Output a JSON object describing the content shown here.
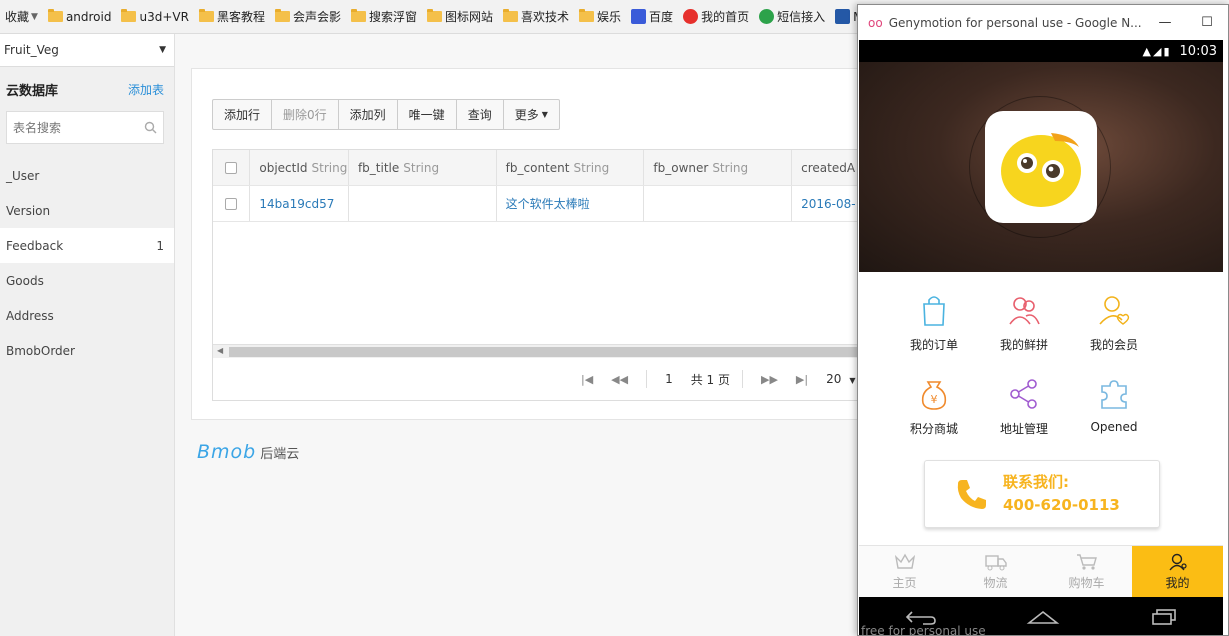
{
  "bookmarks": [
    {
      "label": "收藏",
      "kind": "menu"
    },
    {
      "label": "android",
      "kind": "folder"
    },
    {
      "label": "u3d+VR",
      "kind": "folder"
    },
    {
      "label": "黑客教程",
      "kind": "folder"
    },
    {
      "label": "会声会影",
      "kind": "folder"
    },
    {
      "label": "搜索浮窗",
      "kind": "folder"
    },
    {
      "label": "图标网站",
      "kind": "folder"
    },
    {
      "label": "喜欢技术",
      "kind": "folder"
    },
    {
      "label": "娱乐",
      "kind": "folder"
    },
    {
      "label": "百度",
      "kind": "site"
    },
    {
      "label": "我的首页",
      "kind": "site"
    },
    {
      "label": "短信接入",
      "kind": "site"
    },
    {
      "label": "M",
      "kind": "site"
    }
  ],
  "sidebar": {
    "app_name": "Fruit_Veg",
    "db_title": "云数据库",
    "add_table": "添加表",
    "search_placeholder": "表名搜索",
    "tables": [
      {
        "name": "_User",
        "count": ""
      },
      {
        "name": "Version",
        "count": ""
      },
      {
        "name": "Feedback",
        "count": "1"
      },
      {
        "name": "Goods",
        "count": ""
      },
      {
        "name": "Address",
        "count": ""
      },
      {
        "name": "BmobOrder",
        "count": ""
      }
    ]
  },
  "toolbar": {
    "add_row": "添加行",
    "delete_rows": "删除0行",
    "add_column": "添加列",
    "unique_key": "唯一键",
    "query": "查询",
    "more": "更多"
  },
  "grid": {
    "columns": [
      {
        "name": "objectId",
        "type": "String"
      },
      {
        "name": "fb_title",
        "type": "String"
      },
      {
        "name": "fb_content",
        "type": "String"
      },
      {
        "name": "fb_owner",
        "type": "String"
      },
      {
        "name": "createdA",
        "type": ""
      }
    ],
    "rows": [
      {
        "objectId": "14ba19cd57",
        "fb_title": "",
        "fb_content": "这个软件太棒啦",
        "fb_owner": "",
        "createdAt": "2016-08-"
      }
    ]
  },
  "pager": {
    "page": "1",
    "total": "共 1 页",
    "page_size": "20"
  },
  "brand": {
    "logo": "Bmob",
    "sub": "后端云"
  },
  "genymotion": {
    "title": "Genymotion for personal use - Google N...",
    "watermark": "free for personal use",
    "clock": "10:03",
    "menu": [
      {
        "label": "我的订单",
        "icon": "shopping-bag-icon",
        "color": "#4ab3e0"
      },
      {
        "label": "我的鲜拼",
        "icon": "group-icon",
        "color": "#e8606e"
      },
      {
        "label": "我的会员",
        "icon": "member-icon",
        "color": "#f2b21a"
      },
      {
        "label": "积分商城",
        "icon": "money-bag-icon",
        "color": "#f08a2c"
      },
      {
        "label": "地址管理",
        "icon": "share-icon",
        "color": "#a05bd0"
      },
      {
        "label": "Opened",
        "icon": "puzzle-icon",
        "color": "#7ab8e0"
      }
    ],
    "contact_title": "联系我们:",
    "contact_phone": "400-620-0113",
    "tabs": [
      {
        "label": "主页",
        "icon": "crown-icon"
      },
      {
        "label": "物流",
        "icon": "truck-icon"
      },
      {
        "label": "购物车",
        "icon": "cart-icon"
      },
      {
        "label": "我的",
        "icon": "user-icon"
      }
    ],
    "accent": "#fbbd14"
  }
}
